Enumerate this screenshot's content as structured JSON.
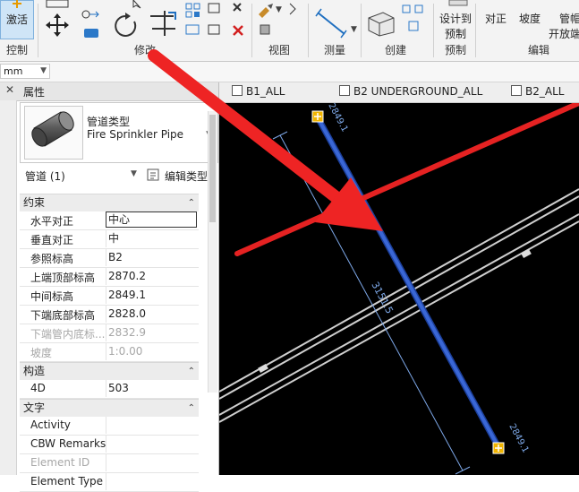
{
  "ribbon": {
    "activate_label": "激活",
    "design_to_label": "设计到",
    "prefab_label": "预制",
    "align_label": "对正",
    "slope_label": "坡度",
    "pipe_top_label": "管帽",
    "open_end_label": "开放端",
    "groups": {
      "control": "控制",
      "modify": "修改",
      "view": "视图",
      "measure": "测量",
      "create": "创建",
      "prefab": "预制",
      "edit": "编辑"
    }
  },
  "options_bar": {
    "units_value": "mm"
  },
  "properties": {
    "panel_title": "属性",
    "type_family": "管道类型",
    "type_name": "Fire Sprinkler Pipe",
    "instance_filter": "管道 (1)",
    "edit_type_label": "编辑类型",
    "sections": {
      "constraints": "约束",
      "construction": "构造",
      "text": "文字"
    },
    "rows": {
      "h_justify": {
        "label": "水平对正",
        "value": "中心"
      },
      "v_justify": {
        "label": "垂直对正",
        "value": "中"
      },
      "ref_level": {
        "label": "参照标高",
        "value": "B2"
      },
      "top_elev": {
        "label": "上端顶部标高",
        "value": "2870.2"
      },
      "mid_elev": {
        "label": "中间标高",
        "value": "2849.1"
      },
      "bottom_elev": {
        "label": "下端底部标高",
        "value": "2828.0"
      },
      "invert_elev": {
        "label": "下端管内底标...",
        "value": "2832.9"
      },
      "slope": {
        "label": "坡度",
        "value": "1:0.00"
      },
      "four_d": {
        "label": "4D",
        "value": "503"
      },
      "activity": {
        "label": "Activity",
        "value": ""
      },
      "cbw_remarks": {
        "label": "CBW Remarks",
        "value": ""
      },
      "element_id": {
        "label": "Element ID",
        "value": ""
      },
      "element_type": {
        "label": "Element Type",
        "value": ""
      }
    }
  },
  "tabs": [
    "B1_ALL",
    "B2 UNDERGROUND_ALL",
    "B2_ALL"
  ],
  "canvas": {
    "dimension_text": "3151.5",
    "elev_top_text": "2849.1",
    "elev_bottom_text": "2849.1",
    "colors": {
      "pipe": "#3a67d6",
      "arrow": "#e52222",
      "line": "#cfcfcf",
      "endpoint": "#f0b400"
    }
  }
}
